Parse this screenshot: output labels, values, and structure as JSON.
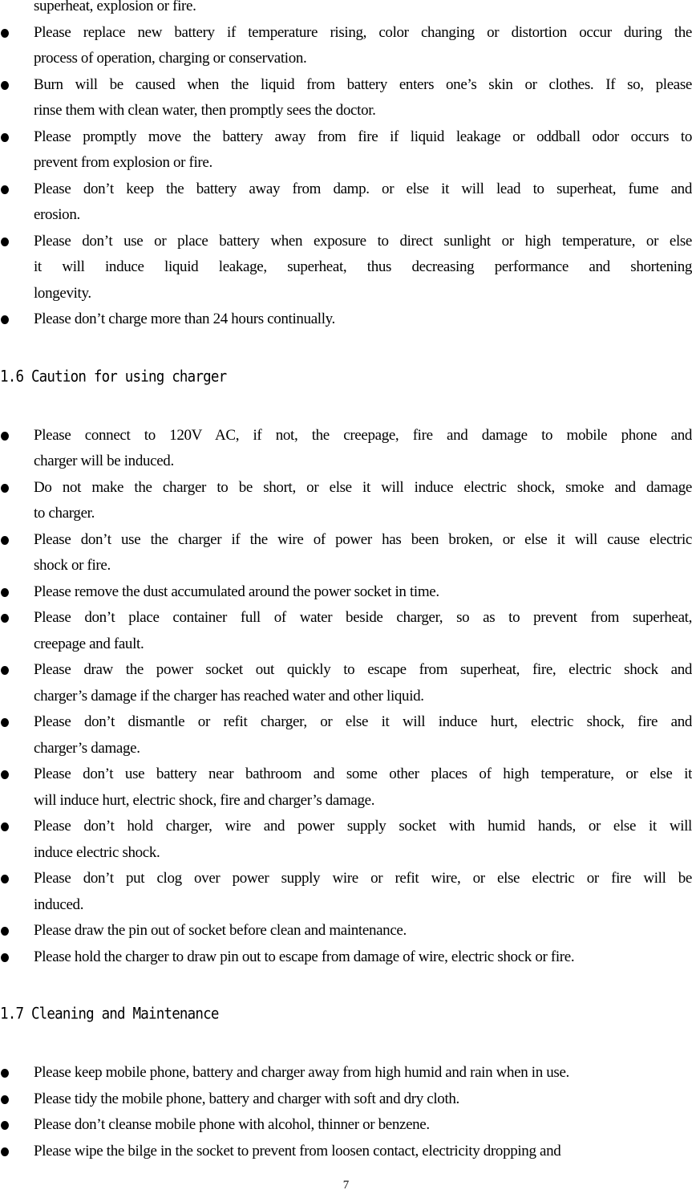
{
  "document": {
    "page_number": "7",
    "intro_continuation": {
      "lines": [
        "superheat, explosion or fire."
      ]
    },
    "battery_cautions": [
      {
        "lines": [
          "Please replace new battery if temperature rising, color changing or distortion occur during the",
          "process of operation, charging or conservation."
        ]
      },
      {
        "lines": [
          "Burn will be caused when the liquid from battery enters one’s skin or clothes. If so, please",
          "rinse them with clean water, then promptly sees the doctor."
        ]
      },
      {
        "lines": [
          "Please promptly move the battery away from fire if liquid leakage or oddball odor occurs to",
          "prevent from explosion or fire."
        ]
      },
      {
        "lines": [
          "Please don’t keep the battery away from damp. or else it will lead to superheat, fume and",
          "erosion."
        ]
      },
      {
        "lines": [
          "Please don’t use or place battery when exposure to direct sunlight or high temperature, or else",
          "it will induce liquid leakage, superheat, thus decreasing performance and shortening",
          "longevity."
        ]
      },
      {
        "lines": [
          "Please don’t charge more than 24 hours continually."
        ]
      }
    ],
    "section_charger": {
      "heading": "1.6 Caution for using charger",
      "items": [
        {
          "lines": [
            "Please connect to 120V AC, if not, the creepage, fire and damage to mobile phone and",
            "charger will be induced."
          ]
        },
        {
          "lines": [
            "Do not make the charger to be short, or else it will induce electric shock, smoke and damage",
            "to charger."
          ]
        },
        {
          "lines": [
            "Please don’t use the charger if the wire of power has been broken, or else it will cause electric",
            "shock or fire."
          ]
        },
        {
          "lines": [
            "Please remove the dust accumulated around the power socket in time."
          ]
        },
        {
          "lines": [
            "Please don’t place container full of water beside charger, so as to prevent from superheat,",
            "creepage and fault."
          ]
        },
        {
          "lines": [
            "Please draw the power socket out quickly to escape from superheat, fire, electric shock and",
            "charger’s damage if the charger has reached water and other liquid."
          ]
        },
        {
          "lines": [
            "Please don’t dismantle or refit charger, or else it will induce hurt, electric shock, fire and",
            "charger’s damage."
          ]
        },
        {
          "lines": [
            "Please don’t use battery near bathroom and some other places of high temperature, or else it",
            "will induce hurt, electric shock, fire and charger’s damage."
          ]
        },
        {
          "lines": [
            "Please don’t hold charger, wire and power supply socket with humid hands, or else it will",
            "induce electric shock."
          ]
        },
        {
          "lines": [
            "Please don’t put clog over power supply wire or refit wire, or else electric or fire will be",
            "induced."
          ]
        },
        {
          "lines": [
            "Please draw the pin out of socket before clean and maintenance."
          ]
        },
        {
          "lines": [
            "Please hold the charger to draw pin out to escape from damage of wire, electric shock or fire."
          ]
        }
      ]
    },
    "section_cleaning": {
      "heading": "1.7 Cleaning and Maintenance",
      "items": [
        {
          "lines": [
            "Please keep mobile phone, battery and charger away from high humid and rain when in use."
          ]
        },
        {
          "lines": [
            "Please tidy the mobile phone, battery and charger with soft and dry cloth."
          ]
        },
        {
          "lines": [
            "Please don’t cleanse mobile phone with alcohol, thinner or benzene."
          ]
        },
        {
          "lines": [
            "Please wipe the bilge in the socket to prevent from loosen contact, electricity dropping and"
          ]
        }
      ]
    }
  }
}
